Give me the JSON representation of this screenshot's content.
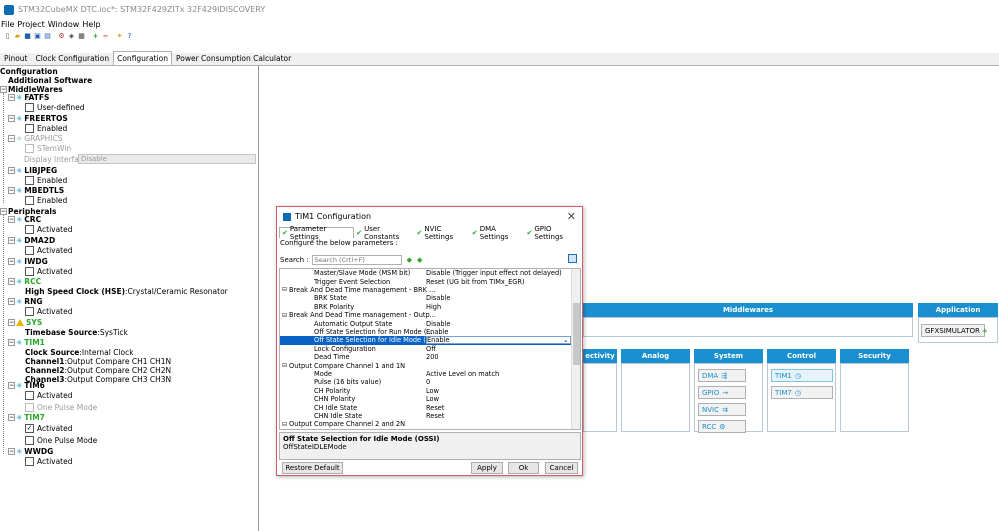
{
  "window": {
    "title": "STM32CubeMX DTC.ioc*: STM32F429ZITx 32F429IDISCOVERY"
  },
  "menu": [
    "File",
    "Project",
    "Window",
    "Help"
  ],
  "toolbar": {
    "icons": [
      "new-file-icon",
      "open-icon",
      "save-icon",
      "save-as-icon",
      "close-icon",
      "generate-icon",
      "import-icon",
      "report-icon",
      "add-icon",
      "remove-icon",
      "zoom-icon",
      "about-icon"
    ]
  },
  "tabs": [
    "Pinout",
    "Clock Configuration",
    "Configuration",
    "Power Consumption Calculator"
  ],
  "tree": {
    "configuration": "Configuration",
    "additional_software": "Additional Software",
    "middlewares": "MiddleWares",
    "fatfs": "FATFS",
    "fatfs_user_defined": "User-defined",
    "freertos": "FREERTOS",
    "freertos_enabled": "Enabled",
    "graphics": "GRAPHICS",
    "stemwin": "STemWin",
    "display_interface_label": "Display Interface",
    "display_interface_value": "Disable",
    "libjpeg": "LIBJPEG",
    "libjpeg_enabled": "Enabled",
    "mbedtls": "MBEDTLS",
    "mbedtls_enabled": "Enabled",
    "peripherals": "Peripherals",
    "crc": "CRC",
    "crc_activated": "Activated",
    "dma2d": "DMA2D",
    "dma2d_activated": "Activated",
    "iwdg": "IWDG",
    "iwdg_activated": "Activated",
    "rcc": "RCC",
    "rcc_hse_label": "High Speed Clock (HSE)",
    "rcc_hse_value": ":Crystal/Ceramic Resonator",
    "rng": "RNG",
    "rng_activated": "Activated",
    "sys": "SYS",
    "sys_timebase_label": "Timebase Source",
    "sys_timebase_value": ":SysTick",
    "tim1": "TIM1",
    "tim1_clock_label": "Clock Source",
    "tim1_clock_value": ":Internal Clock",
    "tim1_ch1_label": "Channel1",
    "tim1_ch1_value": ":Output Compare CH1 CH1N",
    "tim1_ch2_label": "Channel2",
    "tim1_ch2_value": ":Output Compare CH2 CH2N",
    "tim1_ch3_label": "Channel3",
    "tim1_ch3_value": ":Output Compare CH3 CH3N",
    "tim6": "TIM6",
    "tim6_activated": "Activated",
    "tim6_one_pulse": "One Pulse Mode",
    "tim7": "TIM7",
    "tim7_activated": "Activated",
    "tim7_one_pulse": "One Pulse Mode",
    "wwdg": "WWDG",
    "wwdg_activated": "Activated"
  },
  "categories": {
    "middlewares": "Middlewares",
    "application": "Application",
    "gfxsimulator": "GFXSIMULATOR",
    "connectivity": "ectivity",
    "analog": "Analog",
    "system": "System",
    "control": "Control",
    "security": "Security",
    "system_items": [
      "DMA",
      "GPIO",
      "NVIC",
      "RCC"
    ],
    "control_items": [
      "TIM1",
      "TIM7"
    ]
  },
  "dialog": {
    "title": "TIM1 Configuration",
    "tabs": [
      "Parameter Settings",
      "User Constants",
      "NVIC Settings",
      "DMA Settings",
      "GPIO Settings"
    ],
    "subtitle": "Configure the below parameters :",
    "search_label": "Search :",
    "search_placeholder": "Search (Crtl+F)",
    "rows": [
      {
        "name": "Master/Slave Mode (MSM bit)",
        "value": "Disable (Trigger input effect not delayed)"
      },
      {
        "name": "Trigger Event Selection",
        "value": "Reset (UG bit from TIMx_EGR)"
      },
      {
        "name": "Break And Dead Time management - BRK ...",
        "value": "",
        "group": true
      },
      {
        "name": "BRK State",
        "value": "Disable"
      },
      {
        "name": "BRK Polarity",
        "value": "High"
      },
      {
        "name": "Break And Dead Time management - Outp...",
        "value": "",
        "group": true
      },
      {
        "name": "Automatic Output State",
        "value": "Disable"
      },
      {
        "name": "Off State Selection for Run Mode (...",
        "value": "Enable"
      },
      {
        "name": "Off State Selection for Idle Mode (...",
        "value": "Enable",
        "selected": true
      },
      {
        "name": "Lock Configuration",
        "value": "Off"
      },
      {
        "name": "Dead Time",
        "value": "200"
      },
      {
        "name": "Output Compare Channel 1 and 1N",
        "value": "",
        "group": true
      },
      {
        "name": "Mode",
        "value": "Active Level on match"
      },
      {
        "name": "Pulse (16 bits value)",
        "value": "0"
      },
      {
        "name": "CH Polarity",
        "value": "Low"
      },
      {
        "name": "CHN Polarity",
        "value": "Low"
      },
      {
        "name": "CH Idle State",
        "value": "Reset"
      },
      {
        "name": "CHN Idle State",
        "value": "Reset"
      },
      {
        "name": "Output Compare Channel 2 and 2N",
        "value": "",
        "group": true
      }
    ],
    "description_title": "Off State Selection for Idle Mode (OSSI)",
    "description_text": "OffStateIDLEMode",
    "restore_default": "Restore Default",
    "apply": "Apply",
    "ok": "Ok",
    "cancel": "Cancel"
  },
  "colors": {
    "accent": "#1a8fd0",
    "selection": "#0a63c4",
    "ok_green": "#2aa62a",
    "warning": "#e8b400"
  }
}
